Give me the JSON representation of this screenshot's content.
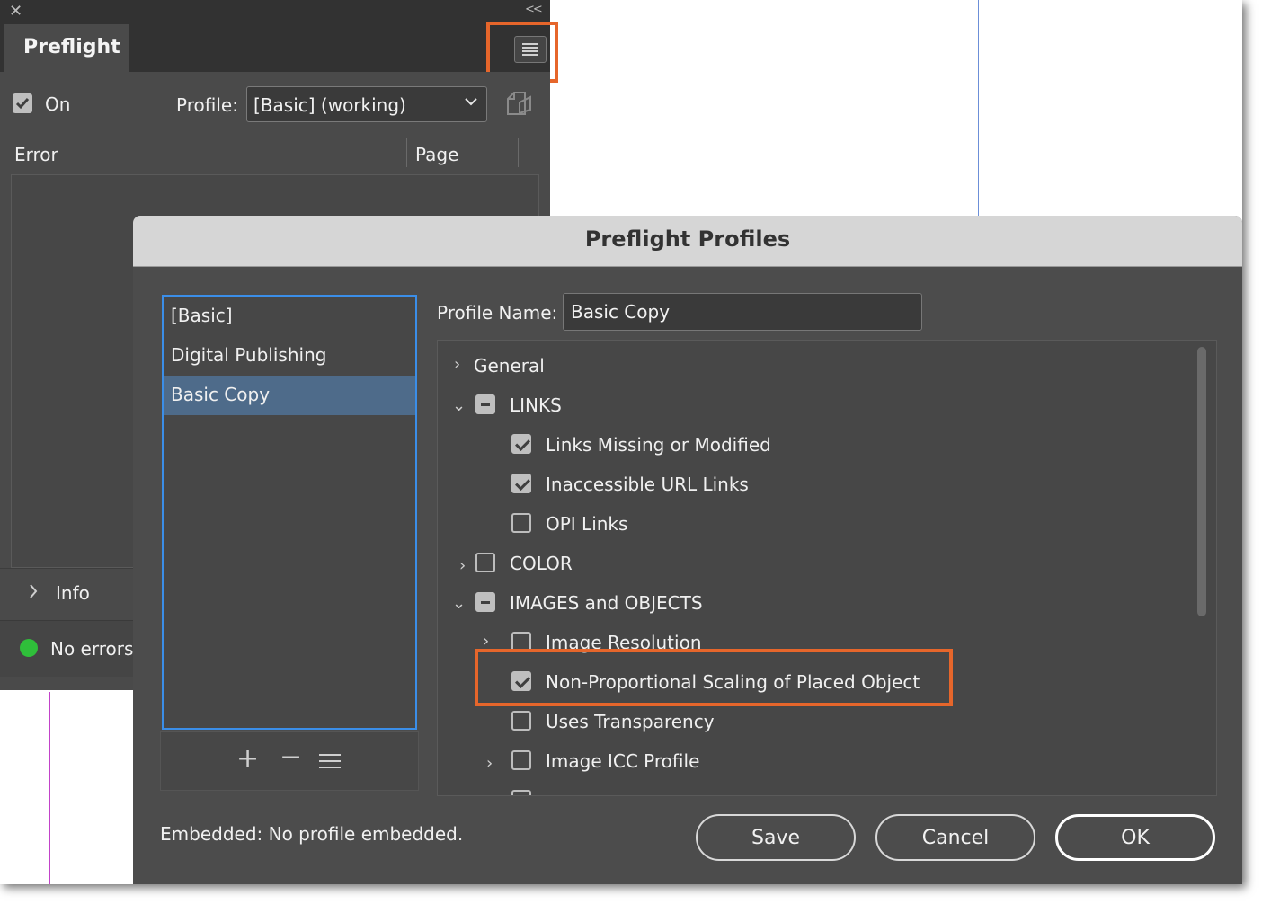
{
  "panel": {
    "tab_label": "Preflight",
    "on_label": "On",
    "on_checked": true,
    "profile_label": "Profile:",
    "profile_value": "[Basic] (working)",
    "columns": {
      "error": "Error",
      "page": "Page"
    },
    "info_label": "Info",
    "status_text": "No errors",
    "status_color": "#2fbf3a"
  },
  "dialog": {
    "title": "Preflight Profiles",
    "profiles": [
      {
        "label": "[Basic]",
        "selected": false
      },
      {
        "label": "Digital Publishing",
        "selected": false
      },
      {
        "label": "Basic Copy",
        "selected": true
      }
    ],
    "profile_name_label": "Profile Name:",
    "profile_name_value": "Basic Copy",
    "tree": [
      {
        "label": "General",
        "twisty": "collapsed",
        "check": "none"
      },
      {
        "label": "LINKS",
        "twisty": "expanded",
        "check": "mixed"
      },
      {
        "label": "Links Missing or Modified",
        "twisty": "none",
        "check": "checked"
      },
      {
        "label": "Inaccessible URL Links",
        "twisty": "none",
        "check": "checked"
      },
      {
        "label": "OPI Links",
        "twisty": "none",
        "check": "unchecked"
      },
      {
        "label": "COLOR",
        "twisty": "collapsed",
        "check": "unchecked"
      },
      {
        "label": "IMAGES and OBJECTS",
        "twisty": "expanded",
        "check": "mixed"
      },
      {
        "label": "Image Resolution",
        "twisty": "collapsed",
        "check": "unchecked"
      },
      {
        "label": "Non-Proportional Scaling of Placed Object",
        "twisty": "none",
        "check": "checked"
      },
      {
        "label": "Uses Transparency",
        "twisty": "none",
        "check": "unchecked"
      },
      {
        "label": "Image ICC Profile",
        "twisty": "collapsed",
        "check": "unchecked"
      }
    ],
    "embedded_text": "Embedded: No profile embedded.",
    "buttons": {
      "save": "Save",
      "cancel": "Cancel",
      "ok": "OK"
    }
  },
  "accent_color": "#e6662b"
}
